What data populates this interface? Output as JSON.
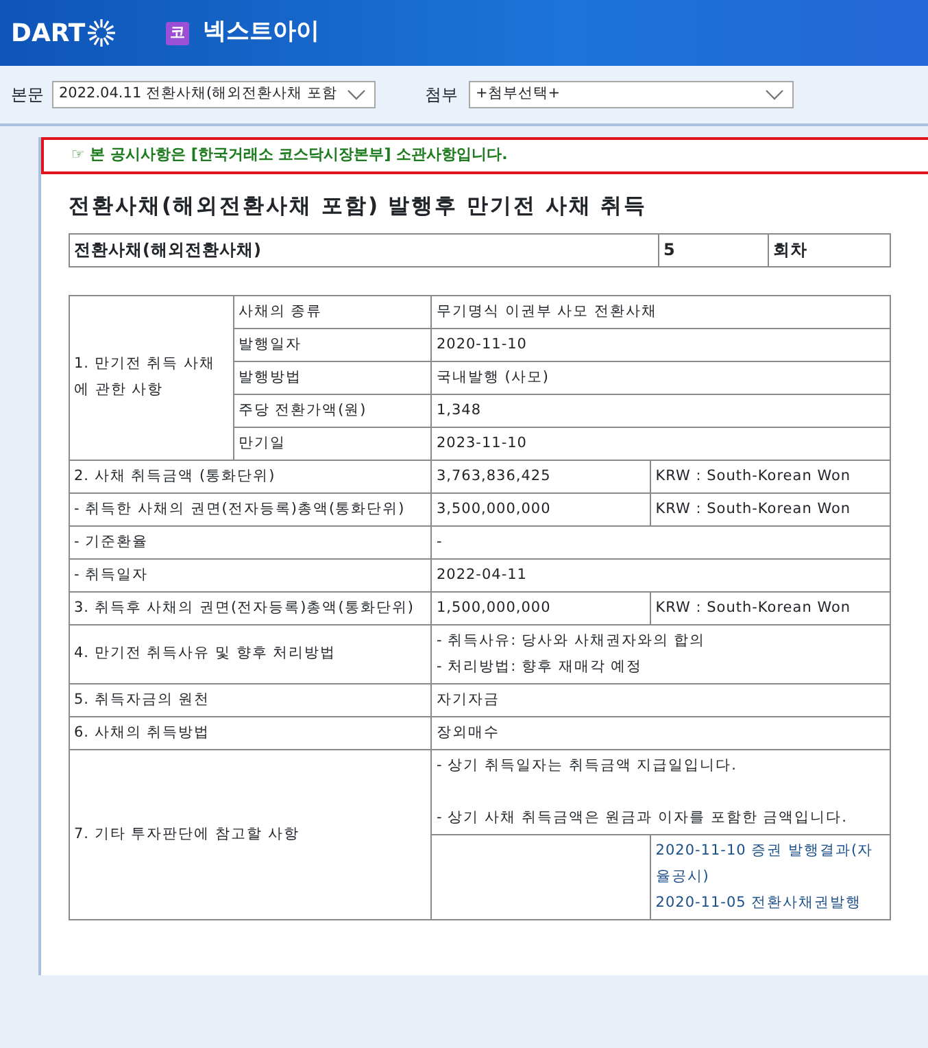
{
  "header": {
    "logo": "DART",
    "company_badge": "코",
    "company_name": "넥스트아이"
  },
  "toolbar": {
    "body_label": "본문",
    "body_select": "2022.04.11  전환사채(해외전환사채 포함",
    "attachment_label": "첨부",
    "attachment_select": "+첨부선택+"
  },
  "notice": "☞ 본 공시사항은 [한국거래소 코스닥시장본부] 소관사항입니다.",
  "title": "전환사채(해외전환사채 포함) 발행후 만기전 사채 취득",
  "summary": {
    "bond_type": "전환사채(해외전환사채)",
    "series": "5",
    "series_unit": "회차"
  },
  "sections": [
    {
      "label": "1. 만기전 취득 사채에 관한 사항",
      "items": [
        {
          "label": "사채의 종류",
          "value": "무기명식 이권부 사모 전환사채"
        },
        {
          "label": "발행일자",
          "value": "2020-11-10"
        },
        {
          "label": "발행방법",
          "value": "국내발행 (사모)"
        },
        {
          "label": "주당 전환가액(원)",
          "value": "1,348"
        },
        {
          "label": "만기일",
          "value": "2023-11-10"
        }
      ]
    },
    {
      "label": "2. 사채 취득금액 (통화단위)",
      "value": "3,763,836,425",
      "unit": "KRW : South-Korean Won"
    },
    {
      "label": "- 취득한 사채의 권면(전자등록)총액(통화단위)",
      "value": "3,500,000,000",
      "unit": "KRW : South-Korean Won"
    },
    {
      "label": "- 기준환율",
      "value": "-"
    },
    {
      "label": "- 취득일자",
      "value": "2022-04-11"
    },
    {
      "label": "3. 취득후 사채의 권면(전자등록)총액(통화단위)",
      "value": "1,500,000,000",
      "unit": "KRW : South-Korean Won"
    },
    {
      "label": "4. 만기전 취득사유 및 향후 처리방법",
      "lines": [
        "- 취득사유: 당사와 사채권자와의 합의",
        "- 처리방법: 향후 재매각 예정"
      ]
    },
    {
      "label": "5. 취득자금의 원천",
      "value": "자기자금"
    },
    {
      "label": "6. 사채의 취득방법",
      "value": "장외매수"
    },
    {
      "label": "7. 기타 투자판단에 참고할 사항",
      "notes": [
        "- 상기 취득일자는 취득금액 지급일입니다.",
        "- 상기 사채 취득금액은 원금과 이자를 포함한 금액입니다."
      ],
      "links": [
        "2020-11-10 증권 발행결과(자율공시)",
        "2020-11-05 전환사채권발행"
      ]
    }
  ]
}
